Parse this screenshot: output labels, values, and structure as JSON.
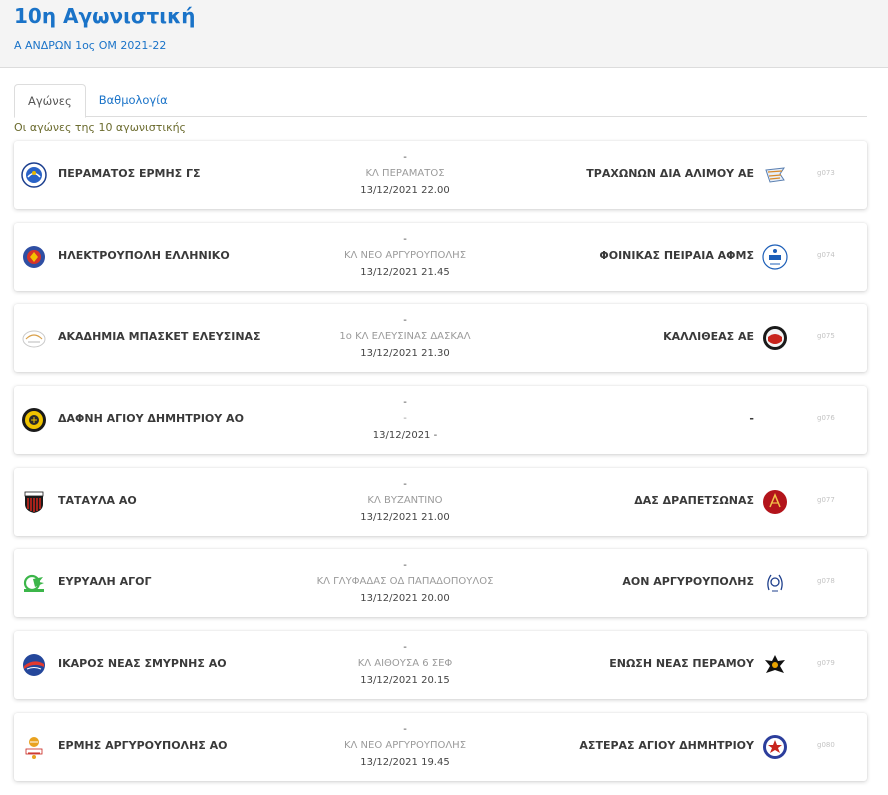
{
  "header": {
    "title": "10η Αγωνιστική",
    "subtitle": "Α ΑΝΔΡΩΝ 1ος ΟΜ 2021-22"
  },
  "tabs": [
    {
      "label": "Αγώνες",
      "active": true
    },
    {
      "label": "Βαθμολογία",
      "active": false
    }
  ],
  "intro": "Οι αγώνες της 10 αγωνιστικής",
  "games": [
    {
      "home": "ΠΕΡΑΜΑΤΟΣ ΕΡΜΗΣ ΓΣ",
      "score": "-",
      "venue": "ΚΛ ΠΕΡΑΜΑΤΟΣ",
      "datetime": "13/12/2021 22.00",
      "away": "ΤΡΑΧΩΝΩΝ ΔΙΑ ΑΛΙΜΟΥ ΑΕ",
      "code": "g073"
    },
    {
      "home": "ΗΛΕΚΤΡΟΥΠΟΛΗ ΕΛΛΗΝΙΚΟ",
      "score": "-",
      "venue": "ΚΛ ΝΕΟ ΑΡΓΥΡΟΥΠΟΛΗΣ",
      "datetime": "13/12/2021 21.45",
      "away": "ΦΟΙΝΙΚΑΣ ΠΕΙΡΑΙΑ ΑΦΜΣ",
      "code": "g074"
    },
    {
      "home": "ΑΚΑΔΗΜΙΑ ΜΠΑΣΚΕΤ ΕΛΕΥΣΙΝΑΣ",
      "score": "-",
      "venue": "1ο ΚΛ ΕΛΕΥΣΙΝΑΣ ΔΑΣΚΑΛ",
      "datetime": "13/12/2021 21.30",
      "away": "ΚΑΛΛΙΘΕΑΣ ΑΕ",
      "code": "g075"
    },
    {
      "home": "ΔΑΦΝΗ ΑΓΙΟΥ ΔΗΜΗΤΡΙΟΥ ΑΟ",
      "score": "-",
      "venue": "-",
      "datetime": "13/12/2021 -",
      "away": "-",
      "code": "g076"
    },
    {
      "home": "ΤΑΤΑΥΛΑ ΑΟ",
      "score": "-",
      "venue": "ΚΛ ΒΥΖΑΝΤΙΝΟ",
      "datetime": "13/12/2021 21.00",
      "away": "ΔΑΣ ΔΡΑΠΕΤΣΩΝΑΣ",
      "code": "g077"
    },
    {
      "home": "ΕΥΡΥΑΛΗ ΑΓΟΓ",
      "score": "-",
      "venue": "ΚΛ ΓΛΥΦΑΔΑΣ ΟΔ ΠΑΠΑΔΟΠΟΥΛΟΣ",
      "datetime": "13/12/2021 20.00",
      "away": "ΑΟΝ ΑΡΓΥΡΟΥΠΟΛΗΣ",
      "code": "g078"
    },
    {
      "home": "ΙΚΑΡΟΣ ΝΕΑΣ ΣΜΥΡΝΗΣ ΑΟ",
      "score": "-",
      "venue": "ΚΛ ΑΙΘΟΥΣΑ 6 ΣΕΦ",
      "datetime": "13/12/2021 20.15",
      "away": "ΕΝΩΣΗ ΝΕΑΣ ΠΕΡΑΜΟΥ",
      "code": "g079"
    },
    {
      "home": "ΕΡΜΗΣ ΑΡΓΥΡΟΥΠΟΛΗΣ ΑΟ",
      "score": "-",
      "venue": "ΚΛ ΝΕΟ ΑΡΓΥΡΟΥΠΟΛΗΣ",
      "datetime": "13/12/2021 19.45",
      "away": "ΑΣΤΕΡΑΣ ΑΓΙΟΥ ΔΗΜΗΤΡΙΟΥ",
      "code": "g080"
    }
  ],
  "colors": {
    "accent": "#1a73c8",
    "intro_text": "#6b6b2e",
    "venue_text": "#9a9a9a"
  }
}
